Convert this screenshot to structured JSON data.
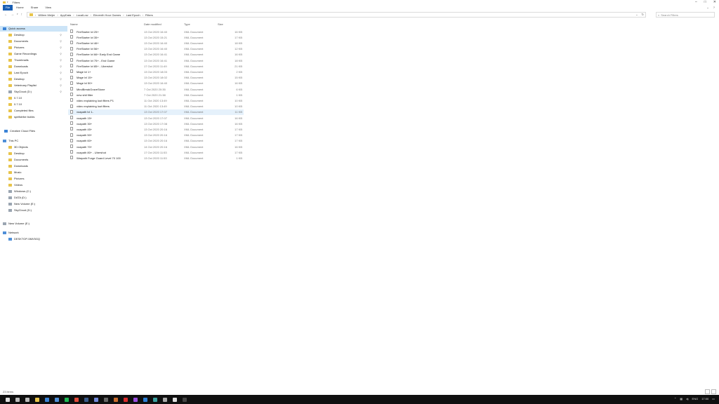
{
  "window": {
    "title": "Filters"
  },
  "ribbon": {
    "tabs": [
      "File",
      "Home",
      "Share",
      "View"
    ]
  },
  "address": {
    "segments": [
      "Willem Meijer",
      "AppData",
      "LocalLow",
      "Eleventh Hour Games",
      "Last Epoch",
      "Filters"
    ]
  },
  "search": {
    "placeholder": "Search Filters"
  },
  "sidebar": {
    "items": [
      {
        "label": "Quick access",
        "icon": "star-icon",
        "pinned": false
      },
      {
        "label": "Desktop",
        "icon": "folder-icon",
        "pinned": true
      },
      {
        "label": "Documents",
        "icon": "folder-icon",
        "pinned": true
      },
      {
        "label": "Pictures",
        "icon": "folder-icon",
        "pinned": true
      },
      {
        "label": "Game Recordings",
        "icon": "folder-icon",
        "pinned": true
      },
      {
        "label": "Thumbnails",
        "icon": "folder-icon",
        "pinned": true
      },
      {
        "label": "Downloads",
        "icon": "folder-icon",
        "pinned": true
      },
      {
        "label": "Last Epoch",
        "icon": "folder-icon",
        "pinned": true
      },
      {
        "label": "Desktop",
        "icon": "folder-icon",
        "pinned": true
      },
      {
        "label": "Veterinary Playlist",
        "icon": "folder-icon",
        "pinned": true
      },
      {
        "label": "SkyCloud (D:)",
        "icon": "drive-icon",
        "pinned": true
      },
      {
        "label": "0.7.10",
        "icon": "folder-icon",
        "pinned": false
      },
      {
        "label": "0.7.10",
        "icon": "folder-icon",
        "pinned": false
      },
      {
        "label": "Completed files",
        "icon": "folder-icon",
        "pinned": false
      },
      {
        "label": "spellstrike builds",
        "icon": "folder-icon",
        "pinned": false
      },
      {
        "label": "Creative Cloud Files",
        "icon": "cloud-icon",
        "pinned": false
      },
      {
        "label": "This PC",
        "icon": "pc-icon",
        "pinned": false
      },
      {
        "label": "3D Objects",
        "icon": "folder-icon",
        "pinned": false
      },
      {
        "label": "Desktop",
        "icon": "folder-icon",
        "pinned": false
      },
      {
        "label": "Documents",
        "icon": "folder-icon",
        "pinned": false
      },
      {
        "label": "Downloads",
        "icon": "folder-icon",
        "pinned": false
      },
      {
        "label": "Music",
        "icon": "folder-icon",
        "pinned": false
      },
      {
        "label": "Pictures",
        "icon": "folder-icon",
        "pinned": false
      },
      {
        "label": "Videos",
        "icon": "folder-icon",
        "pinned": false
      },
      {
        "label": "Windows (C:)",
        "icon": "drive-icon",
        "pinned": false
      },
      {
        "label": "DATA (D:)",
        "icon": "drive-icon",
        "pinned": false
      },
      {
        "label": "New Volume (E:)",
        "icon": "drive-icon",
        "pinned": false
      },
      {
        "label": "SkyCloud (D:)",
        "icon": "drive-icon",
        "pinned": false
      },
      {
        "label": "New Volume (E:)",
        "icon": "drive-icon",
        "pinned": false
      },
      {
        "label": "Network",
        "icon": "network-icon",
        "pinned": false
      },
      {
        "label": "DESKTOP-5MV5GQ",
        "icon": "pc-icon",
        "pinned": false
      }
    ]
  },
  "filelist": {
    "columns": [
      "Name",
      "Date modified",
      "Type",
      "Size"
    ],
    "rows": [
      {
        "name": "FireStarter lvl 25+",
        "date": "13 Oct 2020 16:40",
        "type": "XML Document",
        "size": "16 KB"
      },
      {
        "name": "FireStarter lvl 35+",
        "date": "13 Oct 2020 15:21",
        "type": "XML Document",
        "size": "17 KB"
      },
      {
        "name": "FireStarter lvl 46+",
        "date": "13 Oct 2020 16:40",
        "type": "XML Document",
        "size": "18 KB"
      },
      {
        "name": "FireStarter lvl 56+",
        "date": "13 Oct 2020 16:40",
        "type": "XML Document",
        "size": "12 KB"
      },
      {
        "name": "FireStarter lvl 66+ Early End Game",
        "date": "13 Oct 2020 16:41",
        "type": "XML Document",
        "size": "16 KB"
      },
      {
        "name": "FireStarter lvl 75+ - End Game",
        "date": "13 Oct 2020 16:41",
        "type": "XML Document",
        "size": "18 KB"
      },
      {
        "name": "FireStarter lvl 85+ - Ubershot",
        "date": "17 Oct 2020 11:49",
        "type": "XML Document",
        "size": "21 KB"
      },
      {
        "name": "Mage lvl 1+",
        "date": "13 Oct 2020 18:03",
        "type": "XML Document",
        "size": "2 KB"
      },
      {
        "name": "Mage lvl 15+",
        "date": "13 Oct 2020 18:02",
        "type": "XML Document",
        "size": "15 KB"
      },
      {
        "name": "Mage lvl 50+",
        "date": "13 Oct 2020 16:40",
        "type": "XML Document",
        "size": "16 KB"
      },
      {
        "name": "MindBreakGraveStone",
        "date": "7 Oct 2020 20:35",
        "type": "XML Document",
        "size": "6 KB"
      },
      {
        "name": "new shit filter",
        "date": "7 Oct 2020 21:38",
        "type": "XML Document",
        "size": "1 KB"
      },
      {
        "name": "video explaining loot filters P1",
        "date": "11 Oct 2020 13:49",
        "type": "XML Document",
        "size": "10 KB"
      },
      {
        "name": "video explaining loot filters",
        "date": "11 Oct 2020 13:49",
        "type": "XML Document",
        "size": "10 KB"
      },
      {
        "name": "voapath lvl 1-",
        "date": "13 Oct 2020 17:07",
        "type": "XML Document",
        "size": "11 KB"
      },
      {
        "name": "voapath 15+",
        "date": "13 Oct 2020 17:07",
        "type": "XML Document",
        "size": "16 KB"
      },
      {
        "name": "voapath 30+",
        "date": "13 Oct 2020 17:08",
        "type": "XML Document",
        "size": "16 KB"
      },
      {
        "name": "voapath 45+",
        "date": "13 Oct 2020 20:16",
        "type": "XML Document",
        "size": "17 KB"
      },
      {
        "name": "voapath 50+",
        "date": "13 Oct 2020 20:16",
        "type": "XML Document",
        "size": "17 KB"
      },
      {
        "name": "voapath 60+",
        "date": "13 Oct 2020 20:16",
        "type": "XML Document",
        "size": "17 KB"
      },
      {
        "name": "voapath 70+",
        "date": "14 Oct 2020 20:16",
        "type": "XML Document",
        "size": "16 KB"
      },
      {
        "name": "voapath 80+ - Ubershot",
        "date": "17 Oct 2020 11:53",
        "type": "XML Document",
        "size": "17 KB"
      },
      {
        "name": "Warpath Forge Guard Level 70 100",
        "date": "13 Oct 2020 11:53",
        "type": "XML Document",
        "size": "1 KB"
      }
    ]
  },
  "statusbar": {
    "items_count": "23 items"
  },
  "taskbar": {
    "icons": [
      {
        "name": "start-icon",
        "color": "#dddddd"
      },
      {
        "name": "search-icon",
        "color": "#bbbbbb"
      },
      {
        "name": "task-view-icon",
        "color": "#bbbbbb"
      },
      {
        "name": "file-explorer-icon",
        "color": "#e8c44a"
      },
      {
        "name": "edge-icon",
        "color": "#3b83d6"
      },
      {
        "name": "store-icon",
        "color": "#4f8fd8"
      },
      {
        "name": "spotify-icon",
        "color": "#1db954"
      },
      {
        "name": "chrome-icon",
        "color": "#e04a3a"
      },
      {
        "name": "steam-icon",
        "color": "#3a5a8a"
      },
      {
        "name": "discord-icon",
        "color": "#7289da"
      },
      {
        "name": "obs-icon",
        "color": "#666666"
      },
      {
        "name": "game-icon",
        "color": "#c96b2d"
      },
      {
        "name": "adobe-icon",
        "color": "#da2b2b"
      },
      {
        "name": "app-icon",
        "color": "#9b4de0"
      },
      {
        "name": "app-icon",
        "color": "#2d7fd6"
      },
      {
        "name": "app-icon",
        "color": "#3aa0a0"
      },
      {
        "name": "app-icon",
        "color": "#aaaaaa"
      },
      {
        "name": "app-icon",
        "color": "#e0e0e0"
      },
      {
        "name": "app-icon",
        "color": "#444444"
      }
    ],
    "language": "ENG",
    "time": "17:00"
  },
  "colors": {
    "accent": "#1a5fb4",
    "selection": "#cce4f7",
    "row_hover": "#e5f1fb",
    "folder": "#e8c44a"
  }
}
